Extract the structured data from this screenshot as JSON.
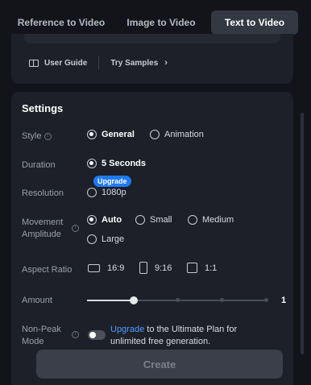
{
  "tabs": [
    {
      "label": "Reference to Video",
      "active": false
    },
    {
      "label": "Image to Video",
      "active": false
    },
    {
      "label": "Text to Video",
      "active": true
    }
  ],
  "links": {
    "user_guide": "User Guide",
    "try_samples": "Try Samples"
  },
  "settings": {
    "title": "Settings",
    "style": {
      "label": "Style",
      "options": [
        "General",
        "Animation"
      ],
      "selected": "General"
    },
    "duration": {
      "label": "Duration",
      "options": [
        "5 Seconds"
      ],
      "selected": "5 Seconds"
    },
    "resolution": {
      "label": "Resolution",
      "options": [
        "1080p"
      ],
      "selected": null,
      "badge": "Upgrade"
    },
    "movement": {
      "label": "Movement Amplitude",
      "options": [
        "Auto",
        "Small",
        "Medium",
        "Large"
      ],
      "selected": "Auto"
    },
    "aspect_ratio": {
      "label": "Aspect Ratio",
      "options": [
        "16:9",
        "9:16",
        "1:1"
      ]
    },
    "amount": {
      "label": "Amount",
      "value": "1",
      "fraction": 0.26
    },
    "non_peak": {
      "label": "Non-Peak Mode",
      "enabled": false,
      "link_text": "Upgrade",
      "text": " to the Ultimate Plan for unlimited free generation."
    }
  },
  "create_button": "Create",
  "colors": {
    "accent": "#1f7aff",
    "link": "#4f9bff",
    "panel": "#1d2029",
    "background": "#12141a"
  }
}
